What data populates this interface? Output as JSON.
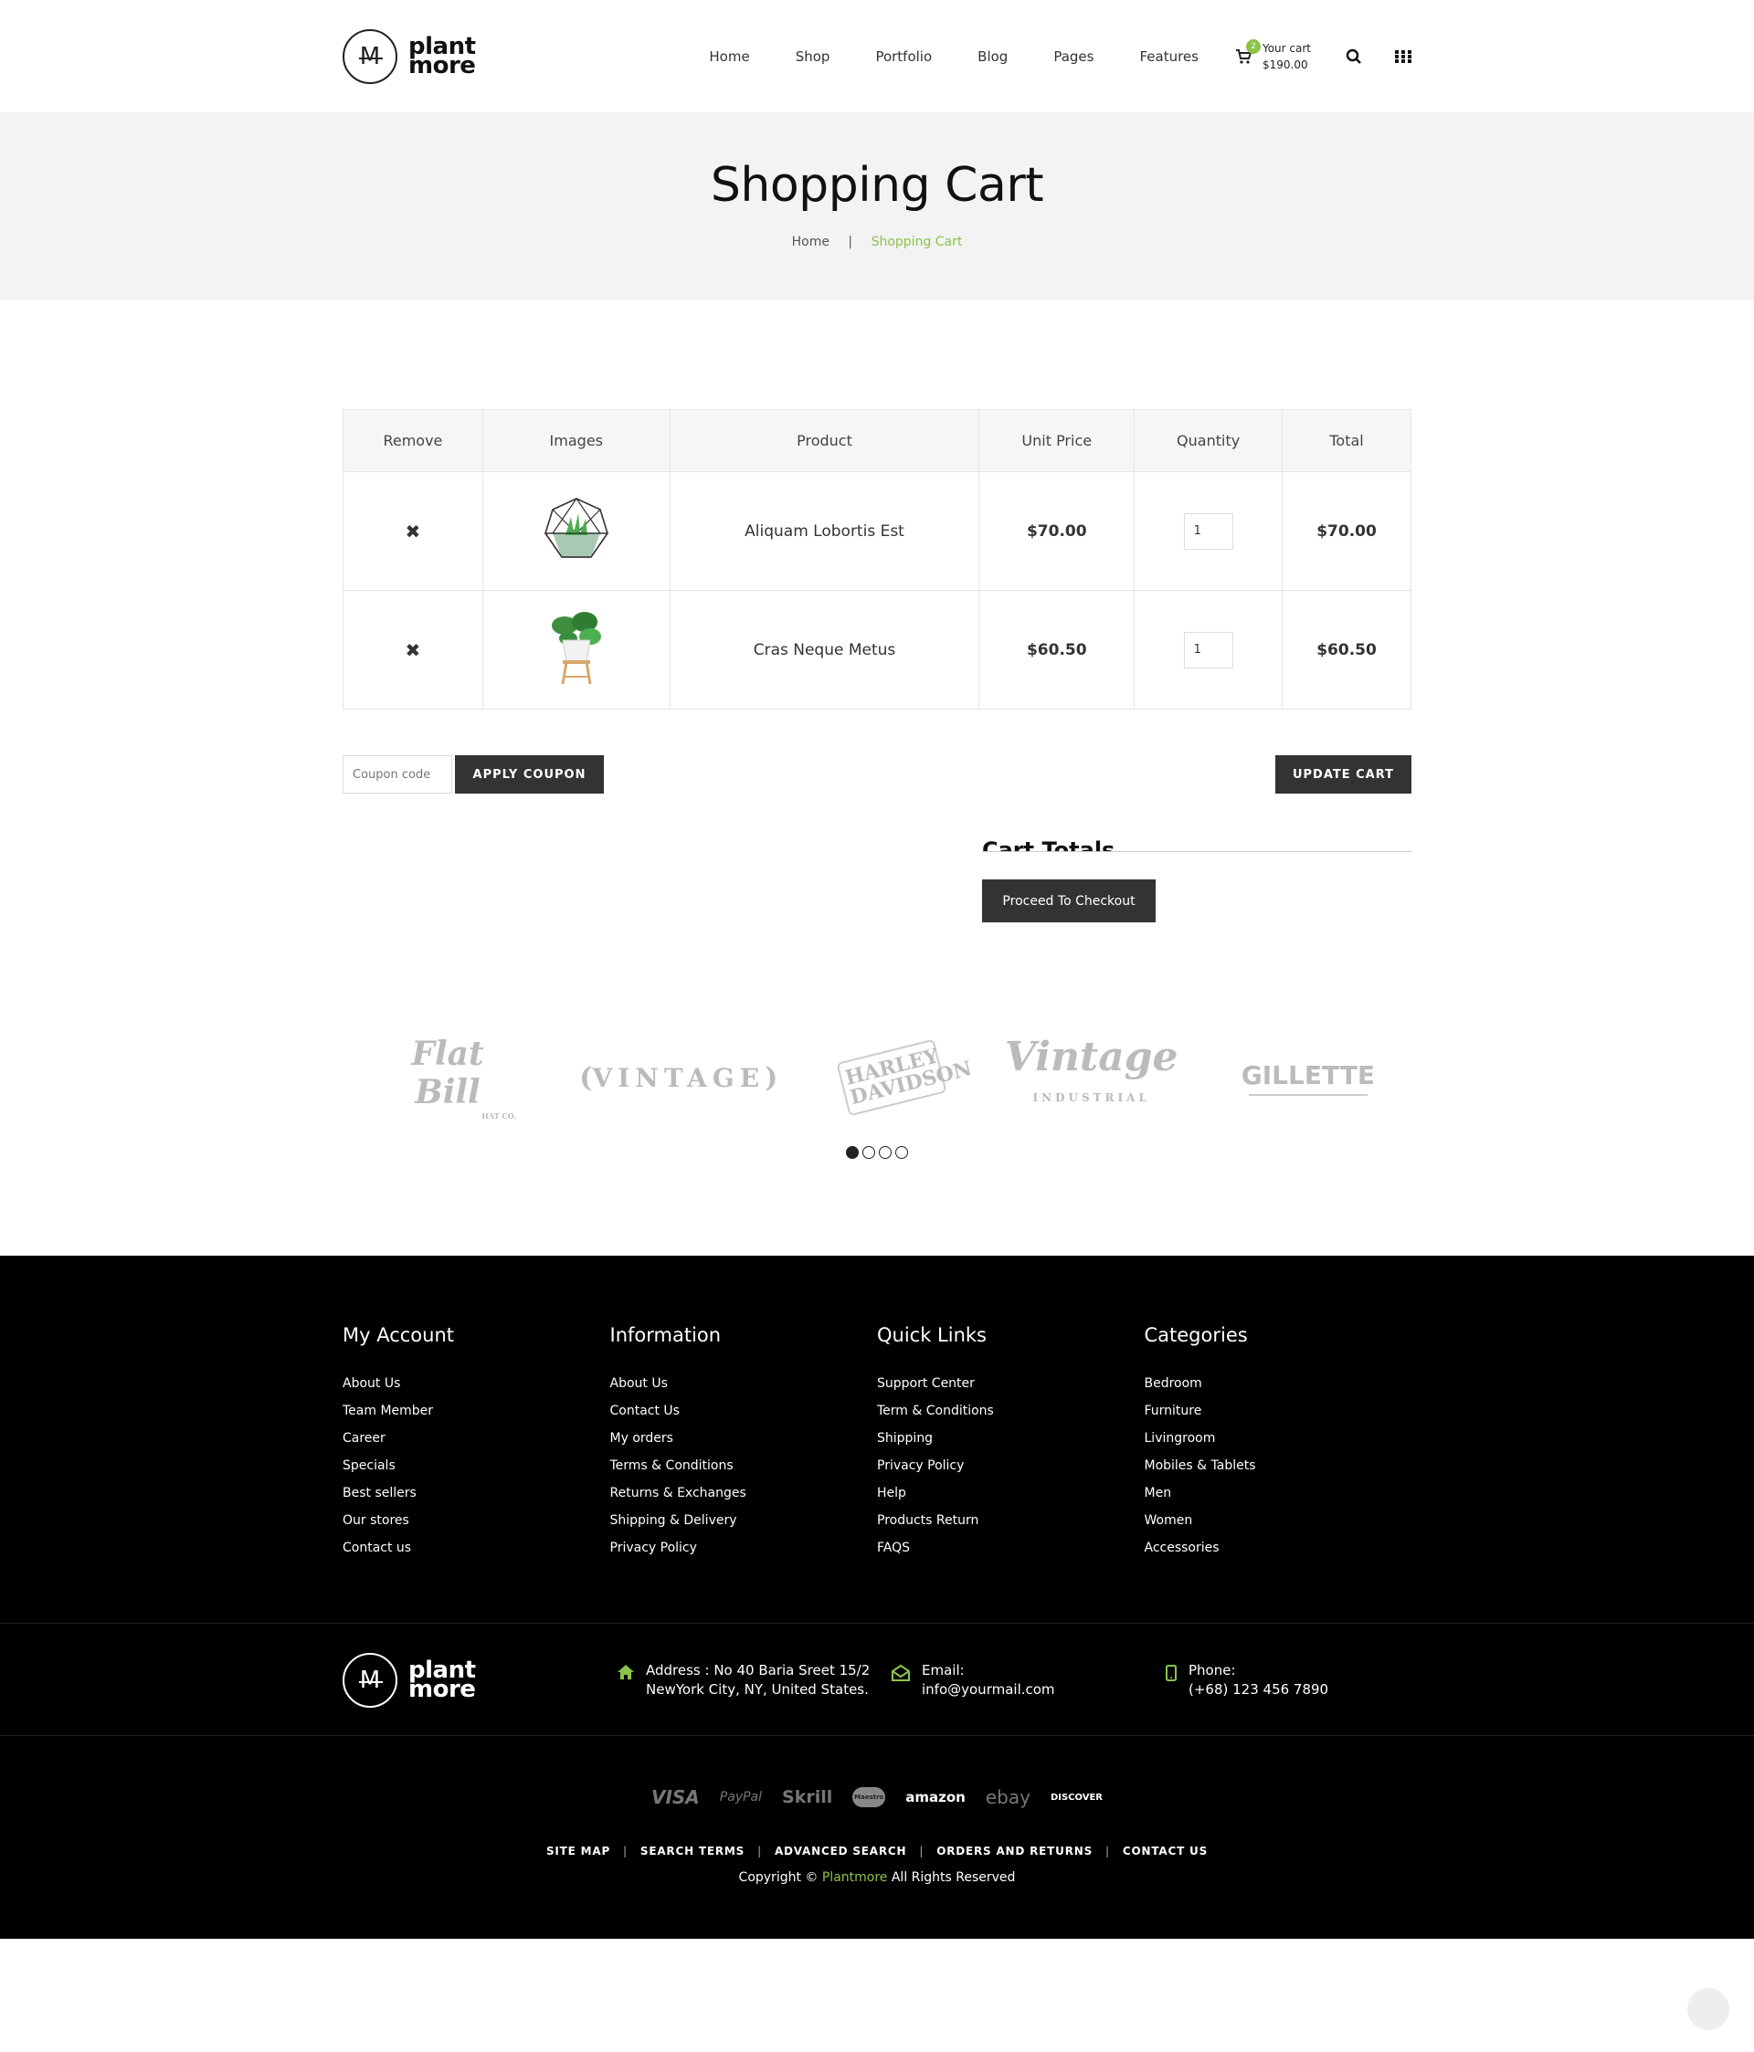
{
  "header": {
    "logo_line1": "plant",
    "logo_line2": "more",
    "logo_mark": "M",
    "nav": [
      "Home",
      "Shop",
      "Portfolio",
      "Blog",
      "Pages",
      "Features"
    ],
    "cart_count": "2",
    "cart_label": "Your cart",
    "cart_total": "$190.00"
  },
  "page_title": {
    "title": "Shopping Cart",
    "breadcrumb_home": "Home",
    "breadcrumb_sep": "|",
    "breadcrumb_current": "Shopping Cart"
  },
  "cart": {
    "headers": [
      "Remove",
      "Images",
      "Product",
      "Unit Price",
      "Quantity",
      "Total"
    ],
    "rows": [
      {
        "remove": "✖",
        "product": "Aliquam Lobortis Est",
        "price": "$70.00",
        "qty": "1",
        "total": "$70.00",
        "image": "geometric-terrarium-plant"
      },
      {
        "remove": "✖",
        "product": "Cras Neque Metus",
        "price": "$60.50",
        "qty": "1",
        "total": "$60.50",
        "image": "potted-plant-on-stand"
      }
    ],
    "coupon_placeholder": "Coupon code",
    "apply_coupon": "APPLY COUPON",
    "update_cart": "UPDATE CART",
    "totals_title": "Cart Totals",
    "checkout": "Proceed To Checkout"
  },
  "brands": [
    "Flat Bill",
    "VINTAGE",
    "HARLEY DAVIDSON",
    "Vintage",
    "GILLETTE"
  ],
  "brand_vintage_sub": "INDUSTRIAL",
  "brand_flatbill_sub": "HAT CO.",
  "footer": {
    "columns": [
      {
        "title": "My Account",
        "items": [
          "About Us",
          "Team Member",
          "Career",
          "Specials",
          "Best sellers",
          "Our stores",
          "Contact us"
        ]
      },
      {
        "title": "Information",
        "items": [
          "About Us",
          "Contact Us",
          "My orders",
          "Terms & Conditions",
          "Returns & Exchanges",
          "Shipping & Delivery",
          "Privacy Policy"
        ]
      },
      {
        "title": "Quick Links",
        "items": [
          "Support Center",
          "Term & Conditions",
          "Shipping",
          "Privacy Policy",
          "Help",
          "Products Return",
          "FAQS"
        ]
      },
      {
        "title": "Categories",
        "items": [
          "Bedroom",
          "Furniture",
          "Livingroom",
          "Mobiles & Tablets",
          "Men",
          "Women",
          "Accessories"
        ]
      }
    ],
    "address_line1": "Address : No 40 Baria Sreet 15/2",
    "address_line2": "NewYork City, NY, United States.",
    "email_label": "Email:",
    "email": "info@yourmail.com",
    "phone_label": "Phone:",
    "phone": "(+68) 123 456 7890",
    "payments": [
      "VISA",
      "PayPal",
      "Skrill",
      "Maestro",
      "amazon",
      "ebay",
      "DISCOVER"
    ],
    "links": [
      "SITE MAP",
      "SEARCH TERMS",
      "ADVANCED SEARCH",
      "ORDERS AND RETURNS",
      "CONTACT US"
    ],
    "copyright_prefix": "Copyright ©",
    "copyright_brand": "Plantmore",
    "copyright_suffix": "All Rights Reserved"
  },
  "colors": {
    "accent": "#8bc34a",
    "dark": "#333333",
    "footer_bg": "#000000"
  }
}
